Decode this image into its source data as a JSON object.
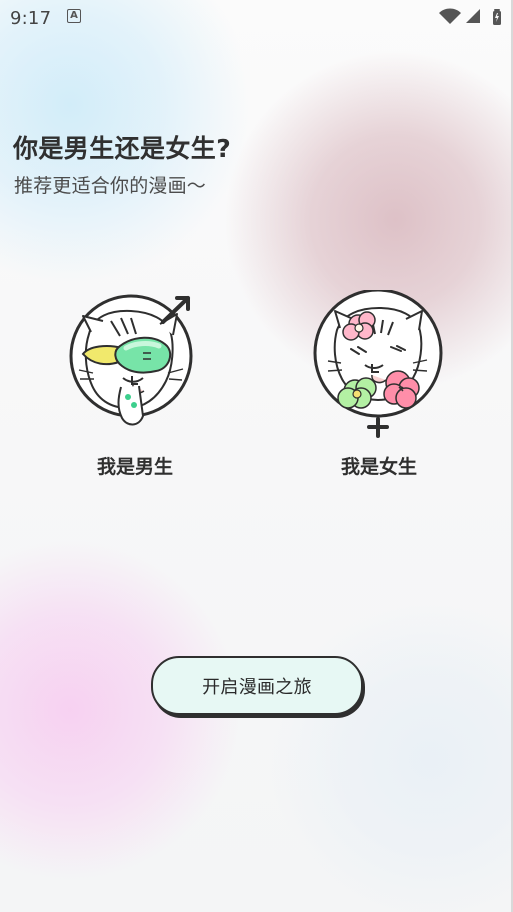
{
  "status_bar": {
    "time": "9:17",
    "notification_icon": "a-icon",
    "network_icons": [
      "wifi-icon",
      "signal-icon",
      "battery-icon"
    ]
  },
  "header": {
    "title": "你是男生还是女生?",
    "subtitle": "推荐更适合你的漫画～"
  },
  "choices": {
    "male": {
      "label": "我是男生",
      "icon": "male-symbol-icon"
    },
    "female": {
      "label": "我是女生",
      "icon": "female-symbol-icon"
    }
  },
  "footer": {
    "start_label": "开启漫画之旅"
  },
  "colors": {
    "button_fill": "#e7f8f4",
    "text_dark": "#2f2f2f",
    "blue_glow": "#d0ecf9",
    "pink_glow": "#f7cff1",
    "rose_glow": "#dcbec4"
  }
}
